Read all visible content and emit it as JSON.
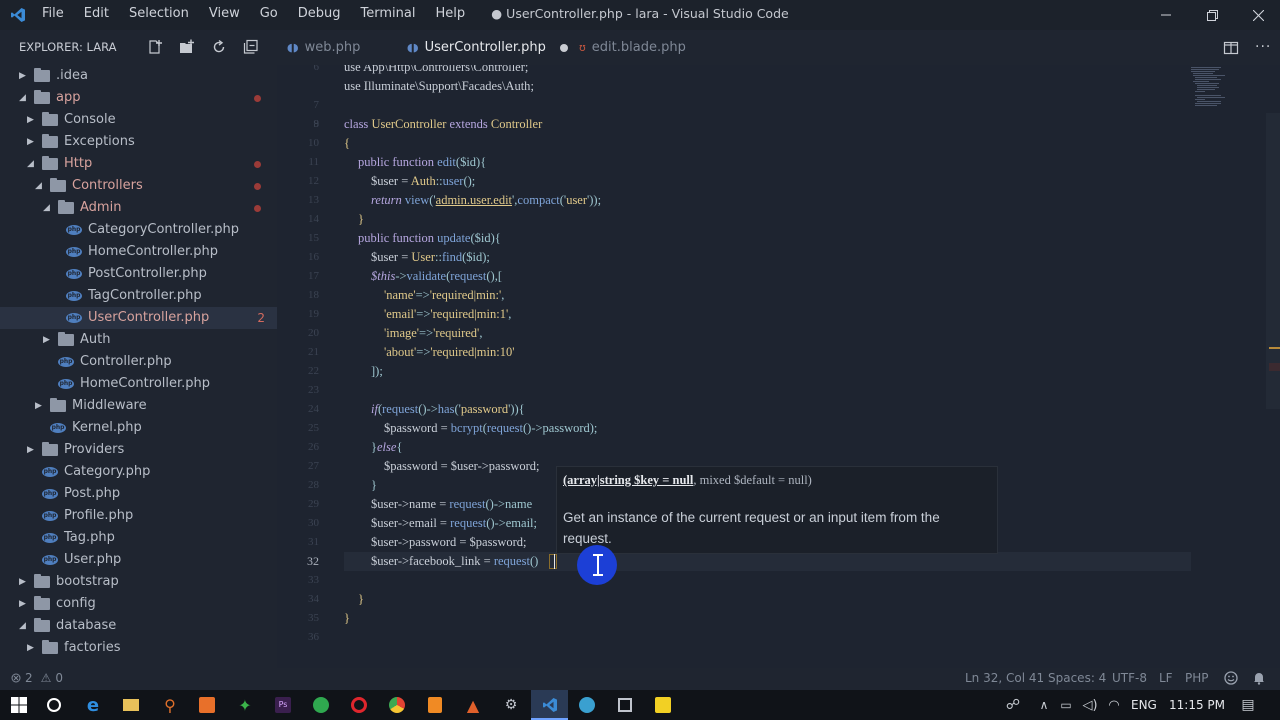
{
  "titlebar": {
    "menu": [
      "File",
      "Edit",
      "Selection",
      "View",
      "Go",
      "Debug",
      "Terminal",
      "Help"
    ],
    "title": "● UserController.php - lara - Visual Studio Code"
  },
  "sidebar": {
    "header": "EXPLORER: LARA",
    "items": [
      {
        "label": "idea",
        "prefix": ".",
        "kind": "folder",
        "state": "collapsed",
        "depth": 0
      },
      {
        "label": "app",
        "kind": "folder",
        "state": "expanded",
        "depth": 0,
        "modified": true
      },
      {
        "label": "Console",
        "kind": "folder",
        "state": "collapsed",
        "depth": 1
      },
      {
        "label": "Exceptions",
        "kind": "folder",
        "state": "collapsed",
        "depth": 1
      },
      {
        "label": "Http",
        "kind": "folder",
        "state": "expanded",
        "depth": 1,
        "modified": true
      },
      {
        "label": "Controllers",
        "kind": "folder",
        "state": "expanded",
        "depth": 2,
        "modified": true
      },
      {
        "label": "Admin",
        "kind": "folder",
        "state": "expanded",
        "depth": 3,
        "modified": true
      },
      {
        "label": "CategoryController.php",
        "kind": "php",
        "depth": 4
      },
      {
        "label": "HomeController.php",
        "kind": "php",
        "depth": 4
      },
      {
        "label": "PostController.php",
        "kind": "php",
        "depth": 4
      },
      {
        "label": "TagController.php",
        "kind": "php",
        "depth": 4
      },
      {
        "label": "UserController.php",
        "kind": "php",
        "depth": 4,
        "selected": true,
        "badge": "2"
      },
      {
        "label": "Auth",
        "kind": "folder",
        "state": "collapsed",
        "depth": 3
      },
      {
        "label": "Controller.php",
        "kind": "php",
        "depth": 3
      },
      {
        "label": "HomeController.php",
        "kind": "php",
        "depth": 3
      },
      {
        "label": "Middleware",
        "kind": "folder",
        "state": "collapsed",
        "depth": 2
      },
      {
        "label": "Kernel.php",
        "kind": "php",
        "depth": 2
      },
      {
        "label": "Providers",
        "kind": "folder",
        "state": "collapsed",
        "depth": 1
      },
      {
        "label": "Category.php",
        "kind": "php",
        "depth": 1
      },
      {
        "label": "Post.php",
        "kind": "php",
        "depth": 1
      },
      {
        "label": "Profile.php",
        "kind": "php",
        "depth": 1
      },
      {
        "label": "Tag.php",
        "kind": "php",
        "depth": 1
      },
      {
        "label": "User.php",
        "kind": "php",
        "depth": 1
      },
      {
        "label": "bootstrap",
        "kind": "folder",
        "state": "collapsed",
        "depth": 0
      },
      {
        "label": "config",
        "kind": "folder",
        "state": "collapsed",
        "depth": 0
      },
      {
        "label": "database",
        "kind": "folder",
        "state": "expanded",
        "depth": 0
      },
      {
        "label": "factories",
        "kind": "folder",
        "state": "collapsed",
        "depth": 1
      }
    ]
  },
  "tabs": [
    {
      "label": "web.php",
      "active": false
    },
    {
      "label": "UserController.php",
      "active": true,
      "dirty": true
    },
    {
      "label": "edit.blade.php",
      "active": false
    }
  ],
  "editor": {
    "line_numbers": [
      "6",
      "7",
      "8",
      "9",
      "10",
      "11",
      "12",
      "13",
      "14",
      "15",
      "16",
      "17",
      "18",
      "19",
      "20",
      "21",
      "22",
      "23",
      "24",
      "25",
      "26",
      "27",
      "28",
      "29",
      "30",
      "31",
      "32",
      "33",
      "34",
      "35",
      "36"
    ],
    "current_line": "32",
    "lines": {
      "l6": "use App\\Http\\Controllers\\Controller;",
      "l7a": "use ",
      "l7b": "Illuminate\\Support\\Facades\\Auth",
      "l7c": ";",
      "l9a": "class ",
      "l9b": "UserController",
      "l9c": " extends ",
      "l9d": "Controller",
      "l10": "{",
      "l11a": "public function ",
      "l11b": "edit",
      "l11c": "($id){",
      "l12a": "$user = ",
      "l12b": "Auth",
      "l12c": "::",
      "l12d": "user",
      "l12e": "();",
      "l13a": "return ",
      "l13b": "view",
      "l13c": "('",
      "l13d": "admin.user.edit",
      "l13e": "',",
      "l13f": "compact",
      "l13g": "('",
      "l13h": "user",
      "l13i": "'));",
      "l14": "}",
      "l15a": "public function ",
      "l15b": "update",
      "l15c": "($id){",
      "l16a": "$user = ",
      "l16b": "User",
      "l16c": "::",
      "l16d": "find",
      "l16e": "($id);",
      "l17a": "$this",
      "l17b": "->",
      "l17c": "validate",
      "l17d": "(",
      "l17e": "request",
      "l17f": "(),[",
      "l18a": "'name'",
      "l18b": "=>",
      "l18c": "'required|min:'",
      "l18d": ",",
      "l19a": "'email'",
      "l19b": "=>",
      "l19c": "'required|min:1'",
      "l19d": ",",
      "l20a": "'image'",
      "l20b": "=>",
      "l20c": "'required'",
      "l20d": ",",
      "l21a": "'about'",
      "l21b": "=>",
      "l21c": "'required|min:10'",
      "l22": "]);",
      "l24a": "if",
      "l24b": "(",
      "l24c": "request",
      "l24d": "()->",
      "l24e": "has",
      "l24f": "('",
      "l24g": "password",
      "l24h": "')){",
      "l25a": "$password = ",
      "l25b": "bcrypt",
      "l25c": "(",
      "l25d": "request",
      "l25e": "()->password);",
      "l26a": "}",
      "l26b": "else",
      "l26c": "{",
      "l27": "$password = $user->password;",
      "l28": "}",
      "l29a": "$user->name = ",
      "l29b": "request",
      "l29c": "()->name",
      "l30a": "$user->email = ",
      "l30b": "request",
      "l30c": "()->email;",
      "l31": "$user->password = $password;",
      "l32a": "$user->facebook_link = ",
      "l32b": "request",
      "l32c": "()",
      "l34": "}",
      "l35": "}"
    }
  },
  "hover": {
    "sig_type": "(array|string $key = null",
    "sig_rest": ", mixed $default = null)",
    "description": "Get an instance of the current request or an input item from the request."
  },
  "statusbar": {
    "errors": "2",
    "warnings": "0",
    "position": "Ln 32, Col 41",
    "spaces": "Spaces: 4",
    "encoding": "UTF-8",
    "eol": "LF",
    "language": "PHP"
  },
  "taskbar": {
    "language": "ENG",
    "time": "11:15 PM"
  }
}
